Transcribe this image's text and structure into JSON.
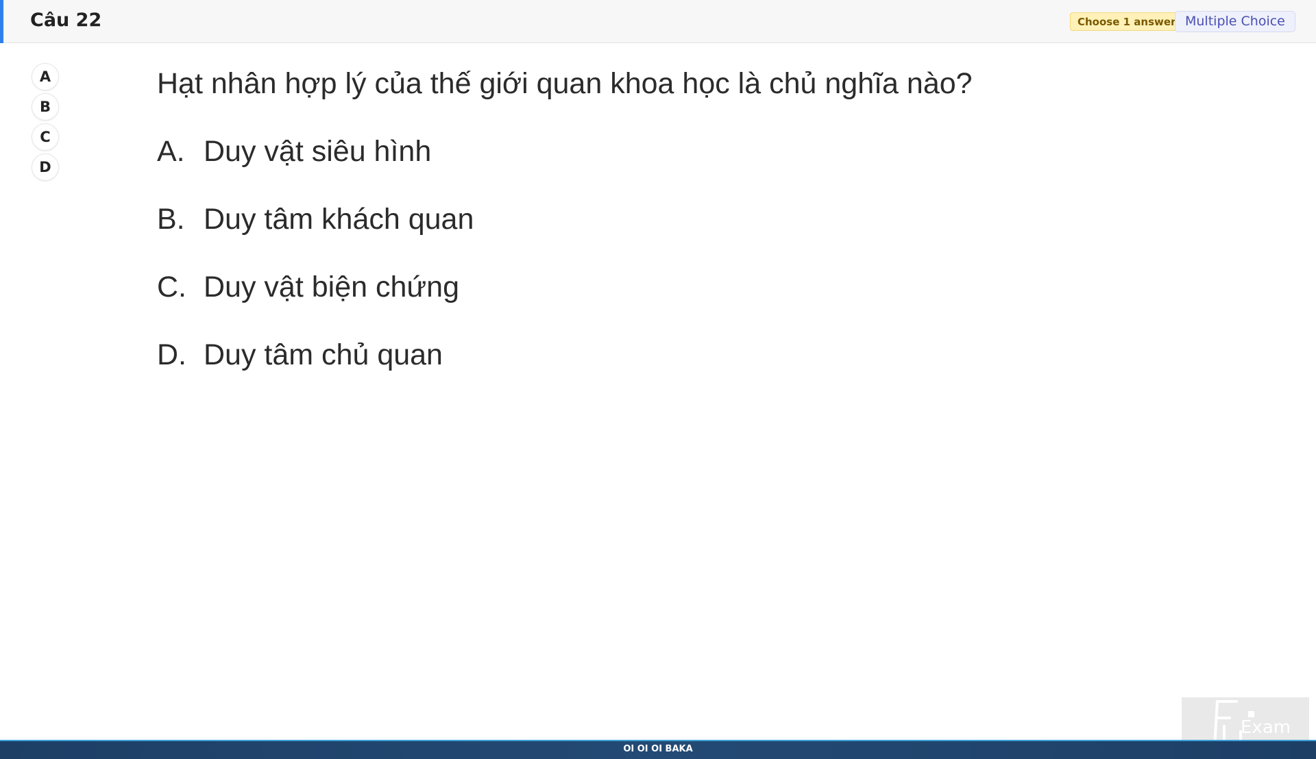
{
  "header": {
    "title": "Câu 22",
    "badge_choose": "Choose 1 answer",
    "badge_type": "Multiple Choice"
  },
  "answer_buttons": [
    "A",
    "B",
    "C",
    "D"
  ],
  "question": {
    "stem": "Hạt nhân hợp lý của thế giới quan khoa học là chủ nghĩa nào?",
    "options": [
      {
        "letter": "A.",
        "text": "Duy vật siêu hình"
      },
      {
        "letter": "B.",
        "text": "Duy tâm khách quan"
      },
      {
        "letter": "C.",
        "text": "Duy vật biện chứng"
      },
      {
        "letter": "D.",
        "text": "Duy tâm chủ quan"
      }
    ]
  },
  "logo": {
    "text": "Exam",
    "icon": "fu-exam-logo"
  },
  "footer": {
    "text": "OI OI OI BAKA"
  },
  "colors": {
    "accent": "#2f80ed",
    "footer_bg": "#1d3f66",
    "badge_choose_bg": "#fff1b8",
    "badge_type_text": "#4a4fb3"
  }
}
